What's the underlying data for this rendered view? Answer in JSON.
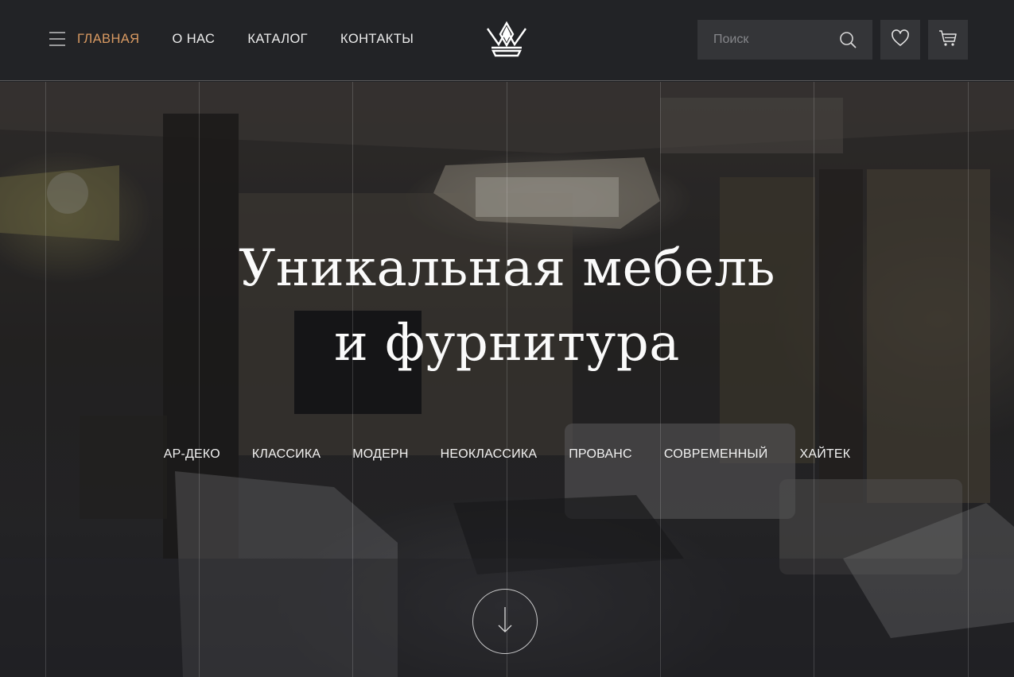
{
  "header": {
    "nav": [
      {
        "label": "ГЛАВНАЯ",
        "active": true
      },
      {
        "label": "О НАС",
        "active": false
      },
      {
        "label": "КАТАЛОГ",
        "active": false
      },
      {
        "label": "КОНТАКТЫ",
        "active": false
      }
    ],
    "search_placeholder": "Поиск",
    "icons": {
      "menu": "hamburger-menu-icon",
      "logo": "crown-logo",
      "search": "search-icon",
      "favorites": "heart-icon",
      "cart": "cart-icon"
    }
  },
  "hero": {
    "headline_line1": "Уникальная мебель",
    "headline_line2": "и фурнитура",
    "styles": [
      "АР-ДЕКО",
      "КЛАССИКА",
      "МОДЕРН",
      "НЕОКЛАССИКА",
      "ПРОВАНС",
      "СОВРЕМЕННЫЙ",
      "ХАЙТЕК"
    ],
    "scroll_icon": "arrow-down-icon"
  },
  "colors": {
    "header_bg": "#222326",
    "accent": "#d99a62",
    "button_bg": "#343538",
    "text": "#ececec"
  }
}
